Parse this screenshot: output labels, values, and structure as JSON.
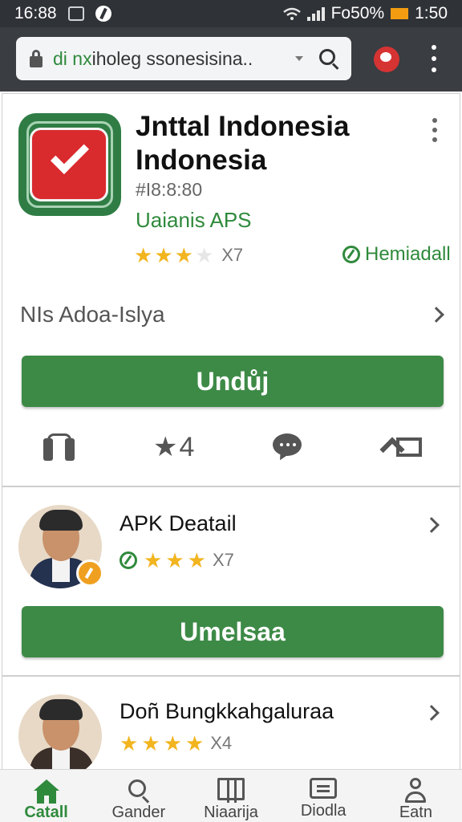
{
  "status_bar": {
    "time": "16:88",
    "carrier": "Fo50%",
    "clock": "1:50"
  },
  "browser": {
    "url_prefix": "di nx",
    "url_text": "iholeg ssonesisina..",
    "icons": [
      "lock-icon",
      "search-icon",
      "profile-icon",
      "more-icon"
    ]
  },
  "app": {
    "title": "Jnttal Indonesia Indonesia",
    "meta": "#I8:8:80",
    "developer": "Uaianis APS",
    "rating_stars": 3,
    "rating_count": "X7",
    "badge_label": "Hemiadall",
    "section_label": "NIs Adoa-Islya",
    "download_label": "Undůj",
    "action_star_count": "4",
    "colors": {
      "accent": "#3d8a47",
      "star": "#f2b520",
      "icon_red": "#d92a2e"
    }
  },
  "list": [
    {
      "title": "APK Deatail",
      "rating_stars": 3,
      "rating_count": "X7",
      "button_label": "Umelsaa"
    },
    {
      "title": "Doñ Bungkkahgaluraa",
      "rating_stars": 4,
      "rating_count": "X4"
    }
  ],
  "bottom_nav": [
    {
      "label": "Catall",
      "icon": "home-icon",
      "active": true
    },
    {
      "label": "Gander",
      "icon": "search-icon",
      "active": false
    },
    {
      "label": "Niaarija",
      "icon": "map-icon",
      "active": false
    },
    {
      "label": "Diodla",
      "icon": "message-icon",
      "active": false
    },
    {
      "label": "Eatn",
      "icon": "person-icon",
      "active": false
    }
  ]
}
